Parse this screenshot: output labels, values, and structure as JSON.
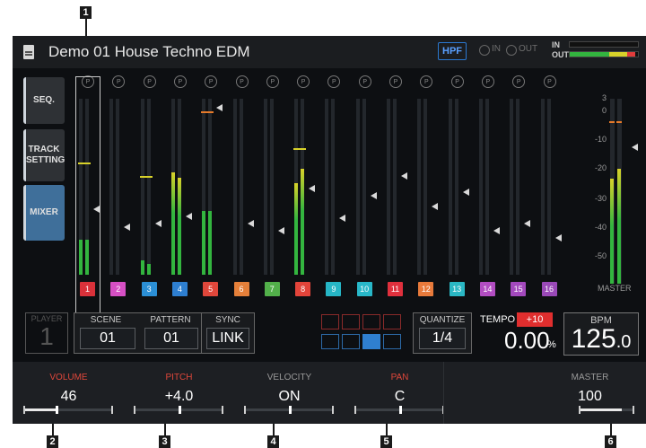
{
  "callouts": [
    "1",
    "2",
    "3",
    "4",
    "5",
    "6"
  ],
  "title": "Demo 01 House Techno EDM",
  "header": {
    "hpf_label": "HPF",
    "in_label": "IN",
    "out_label": "OUT",
    "meter_in_label": "IN",
    "meter_out_label": "OUT",
    "meter_out_level": 0.96
  },
  "side_buttons": [
    {
      "label": "SEQ.",
      "active": false
    },
    {
      "label": "TRACK SETTING",
      "active": false
    },
    {
      "label": "MIXER",
      "active": true
    }
  ],
  "channels": [
    {
      "num": "1",
      "color": "#d9313a",
      "knob": "P",
      "level": 0.2,
      "level2": 0.2,
      "peak": 0.64,
      "fader": 0.37
    },
    {
      "num": "2",
      "color": "#d64fc4",
      "knob": "P",
      "level": 0.0,
      "level2": 0.0,
      "peak": null,
      "fader": 0.27
    },
    {
      "num": "3",
      "color": "#2b8fd6",
      "knob": "P",
      "level": 0.08,
      "level2": 0.06,
      "peak": 0.56,
      "fader": 0.29
    },
    {
      "num": "4",
      "color": "#2e7fd1",
      "knob": "P",
      "level": 0.58,
      "level2": 0.55,
      "peak": null,
      "fader": 0.33
    },
    {
      "num": "5",
      "color": "#e0473b",
      "knob": "P",
      "level": 0.36,
      "level2": 0.36,
      "peak": 0.93,
      "fader": 0.95
    },
    {
      "num": "6",
      "color": "#e5803a",
      "knob": "P",
      "level": 0.0,
      "level2": 0.0,
      "peak": null,
      "fader": 0.29
    },
    {
      "num": "7",
      "color": "#52b04a",
      "knob": "P",
      "level": 0.0,
      "level2": 0.0,
      "peak": null,
      "fader": 0.25
    },
    {
      "num": "8",
      "color": "#e2443a",
      "knob": "P",
      "level": 0.52,
      "level2": 0.6,
      "peak": 0.72,
      "fader": 0.49
    },
    {
      "num": "9",
      "color": "#26b6c6",
      "knob": "P",
      "level": 0.0,
      "level2": 0.0,
      "peak": null,
      "fader": 0.32
    },
    {
      "num": "10",
      "color": "#28b8c9",
      "knob": "P",
      "level": 0.0,
      "level2": 0.0,
      "peak": null,
      "fader": 0.45
    },
    {
      "num": "11",
      "color": "#e0303d",
      "knob": "P",
      "level": 0.0,
      "level2": 0.0,
      "peak": null,
      "fader": 0.56
    },
    {
      "num": "12",
      "color": "#e87a3b",
      "knob": "P",
      "level": 0.0,
      "level2": 0.0,
      "peak": null,
      "fader": 0.39
    },
    {
      "num": "13",
      "color": "#2ab7c4",
      "knob": "P",
      "level": 0.0,
      "level2": 0.0,
      "peak": null,
      "fader": 0.47
    },
    {
      "num": "14",
      "color": "#b24dc2",
      "knob": "P",
      "level": 0.0,
      "level2": 0.0,
      "peak": null,
      "fader": 0.25
    },
    {
      "num": "15",
      "color": "#a349bd",
      "knob": "P",
      "level": 0.0,
      "level2": 0.0,
      "peak": null,
      "fader": 0.29
    },
    {
      "num": "16",
      "color": "#9a49b8",
      "knob": "P",
      "level": 0.0,
      "level2": 0.0,
      "peak": null,
      "fader": 0.21
    }
  ],
  "master": {
    "label": "MASTER",
    "ticks": [
      "3",
      "0",
      "-10",
      "-20",
      "-30",
      "-40",
      "-50"
    ],
    "level_l": 0.57,
    "level_r": 0.62,
    "peak": 0.88,
    "fader": 0.74
  },
  "player": {
    "label": "PLAYER",
    "value": "1"
  },
  "scene": {
    "label": "SCENE",
    "value": "01"
  },
  "pattern": {
    "label": "PATTERN",
    "value": "01"
  },
  "sync": {
    "label": "SYNC",
    "value": "LINK"
  },
  "quantize": {
    "label": "QUANTIZE",
    "value": "1/4"
  },
  "tempo": {
    "label": "TEMPO",
    "badge": "+10",
    "value": "0.00",
    "unit": "%"
  },
  "bpm": {
    "label": "BPM",
    "value": "125",
    "decimal": ".0"
  },
  "params": [
    {
      "label": "VOLUME",
      "label_color": "#e0473b",
      "value": "46",
      "level": 0.36
    },
    {
      "label": "PITCH",
      "label_color": "#e0473b",
      "value": "+4.0",
      "level": 0.5
    },
    {
      "label": "VELOCITY",
      "label_color": "#9a9a9a",
      "value": "ON",
      "level": 0.5
    },
    {
      "label": "PAN",
      "label_color": "#e0473b",
      "value": "C",
      "level": 0.5
    }
  ],
  "master_param": {
    "label": "MASTER",
    "label_color": "#9a9a9a",
    "value": "100",
    "level": 0.78
  }
}
